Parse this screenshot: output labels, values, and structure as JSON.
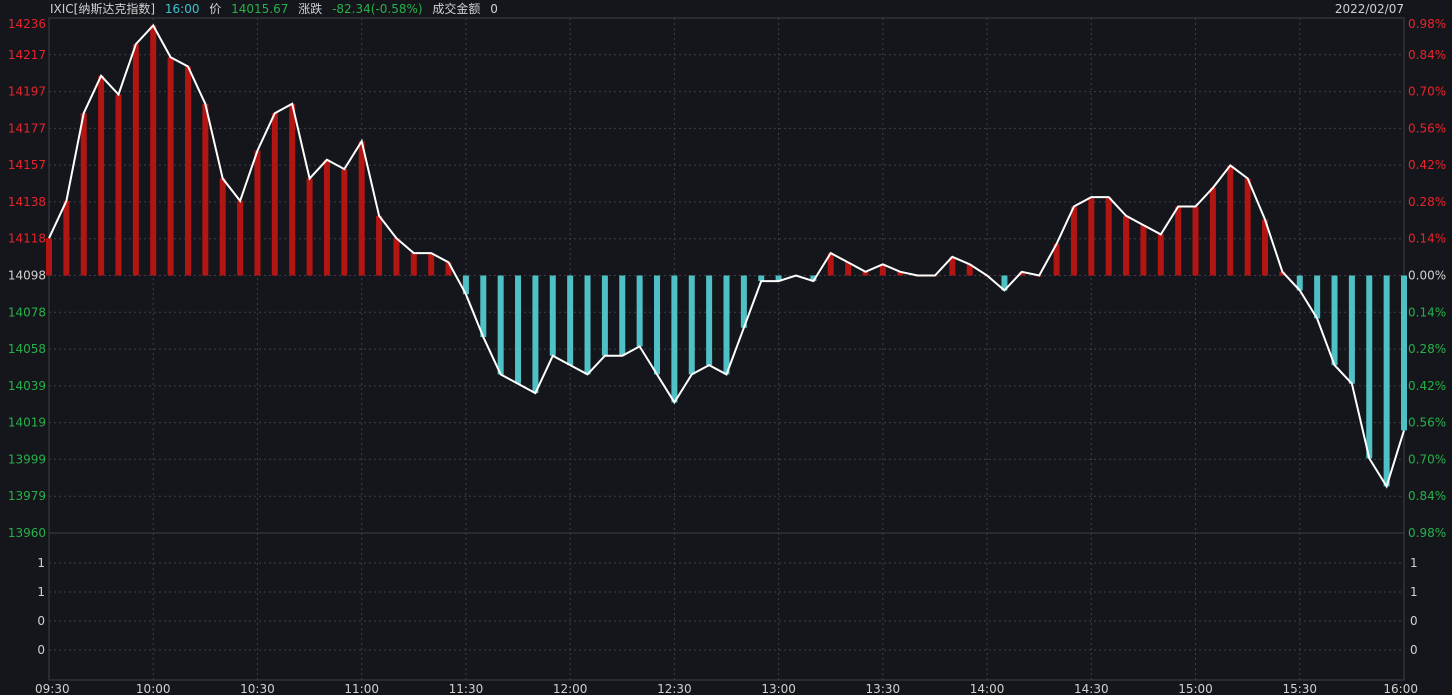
{
  "header": {
    "symbol": "IXIC[纳斯达克指数]",
    "time": "16:00",
    "price_label": "价",
    "price": "14015.67",
    "change_label": "涨跌",
    "change": "-82.34(-0.58%)",
    "turnover_label": "成交金额",
    "turnover": "0",
    "date": "2022/02/07"
  },
  "colors": {
    "up": "#e8242c",
    "down": "#27b04a",
    "neutral": "#d0d0d0",
    "bar_up": "#b31512",
    "bar_down": "#4fc0c6",
    "line": "#ffffff",
    "grid": "#3a4049",
    "background": "#14161b",
    "time_accent": "#3fc2cf"
  },
  "chart_data": {
    "type": "line",
    "base_price": 14098,
    "ylim": [
      13960,
      14236
    ],
    "y_tick_labels": [
      "14236",
      "14217",
      "14197",
      "14177",
      "14157",
      "14138",
      "14118",
      "14098",
      "14078",
      "14058",
      "14039",
      "14019",
      "13999",
      "13979",
      "13960"
    ],
    "pct_tick_labels": [
      "0.98%",
      "0.84%",
      "0.70%",
      "0.56%",
      "0.42%",
      "0.28%",
      "0.14%",
      "0.00%",
      "0.14%",
      "0.28%",
      "0.42%",
      "0.56%",
      "0.70%",
      "0.84%",
      "0.98%"
    ],
    "x_tick_labels": [
      "09:30",
      "10:00",
      "10:30",
      "11:00",
      "11:30",
      "12:00",
      "12:30",
      "13:00",
      "13:30",
      "14:00",
      "14:30",
      "15:00",
      "15:30",
      "16:00"
    ],
    "volume_tick_labels": [
      "1",
      "1",
      "0",
      "0"
    ],
    "series": [
      {
        "x": [
          "09:30",
          "09:35",
          "09:40",
          "09:45",
          "09:50",
          "09:55",
          "10:00",
          "10:05",
          "10:10",
          "10:15",
          "10:20",
          "10:25",
          "10:30",
          "10:35",
          "10:40",
          "10:45",
          "10:50",
          "10:55",
          "11:00",
          "11:05",
          "11:10",
          "11:15",
          "11:20",
          "11:25",
          "11:30",
          "11:35",
          "11:40",
          "11:45",
          "11:50",
          "11:55",
          "12:00",
          "12:05",
          "12:10",
          "12:15",
          "12:20",
          "12:25",
          "12:30",
          "12:35",
          "12:40",
          "12:45",
          "12:50",
          "12:55",
          "13:00",
          "13:05",
          "13:10",
          "13:15",
          "13:20",
          "13:25",
          "13:30",
          "13:35",
          "13:40",
          "13:45",
          "13:50",
          "13:55",
          "14:00",
          "14:05",
          "14:10",
          "14:15",
          "14:20",
          "14:25",
          "14:30",
          "14:35",
          "14:40",
          "14:45",
          "14:50",
          "14:55",
          "15:00",
          "15:05",
          "15:10",
          "15:15",
          "15:20",
          "15:25",
          "15:30",
          "15:35",
          "15:40",
          "15:45",
          "15:50",
          "15:55",
          "16:00"
        ],
        "y": [
          14118,
          14138,
          14185,
          14205,
          14195,
          14222,
          14232,
          14215,
          14210,
          14190,
          14150,
          14138,
          14165,
          14185,
          14190,
          14150,
          14160,
          14155,
          14170,
          14130,
          14118,
          14110,
          14110,
          14105,
          14088,
          14065,
          14045,
          14040,
          14035,
          14055,
          14050,
          14045,
          14055,
          14055,
          14060,
          14045,
          14030,
          14045,
          14050,
          14045,
          14070,
          14095,
          14095,
          14098,
          14095,
          14110,
          14105,
          14100,
          14104,
          14100,
          14098,
          14098,
          14108,
          14104,
          14098,
          14090,
          14100,
          14098,
          14115,
          14135,
          14140,
          14140,
          14130,
          14125,
          14120,
          14135,
          14135,
          14145,
          14157,
          14150,
          14128,
          14100,
          14090,
          14075,
          14050,
          14040,
          14000,
          13985,
          14015
        ]
      }
    ]
  }
}
